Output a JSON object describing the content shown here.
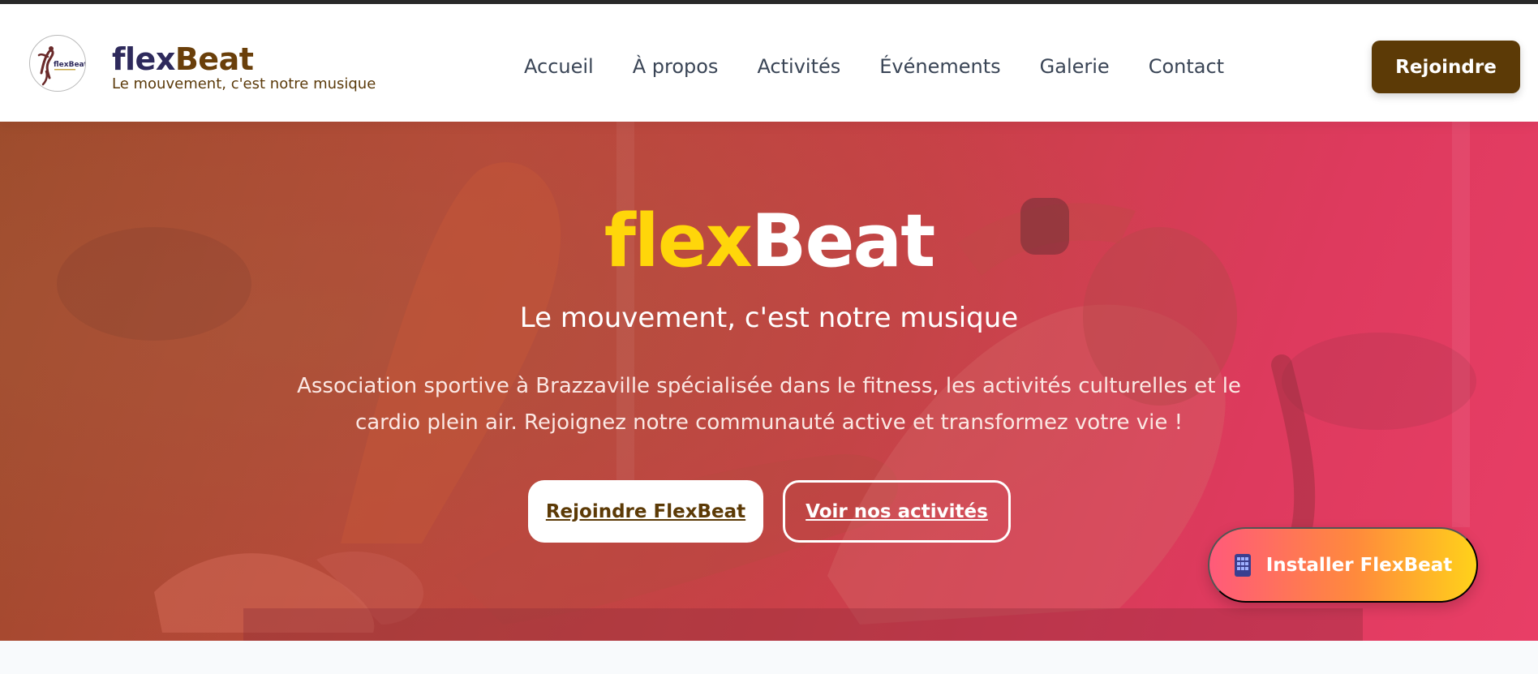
{
  "brand": {
    "name_part1": "flex",
    "name_part2": "Beat",
    "tagline": "Le mouvement, c'est notre musique",
    "logo_text": "flexBeat"
  },
  "nav": {
    "items": [
      {
        "label": "Accueil"
      },
      {
        "label": "À propos"
      },
      {
        "label": "Activités"
      },
      {
        "label": "Événements"
      },
      {
        "label": "Galerie"
      },
      {
        "label": "Contact"
      }
    ],
    "join_label": "Rejoindre"
  },
  "hero": {
    "title_part1": "flex",
    "title_part2": "Beat",
    "subtitle": "Le mouvement, c'est notre musique",
    "description": "Association sportive à Brazzaville spécialisée dans le fitness, les activités culturelles et le cardio plein air. Rejoignez notre communauté active et transformez votre vie !",
    "primary_cta": "Rejoindre FlexBeat",
    "secondary_cta": "Voir nos activités"
  },
  "install": {
    "label": "Installer FlexBeat",
    "icon": "mobile-phone-icon"
  },
  "colors": {
    "brand_brown": "#5c3a06",
    "brand_navy": "#2e2a5c",
    "accent_yellow": "#ffd60a",
    "hero_start": "#9c4a2a",
    "hero_end": "#e83e66"
  }
}
